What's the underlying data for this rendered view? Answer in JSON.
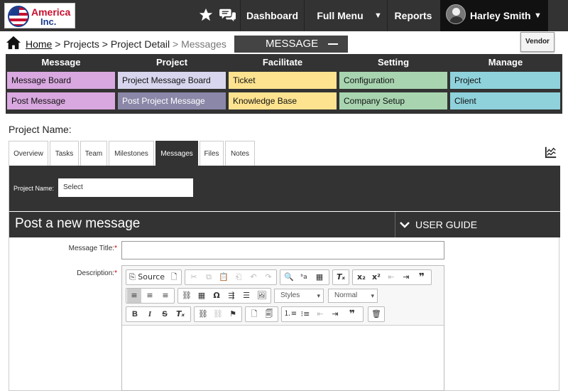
{
  "header": {
    "logo_line1": "America",
    "logo_line2": "Inc.",
    "nav": {
      "dashboard": "Dashboard",
      "full_menu": "Full Menu",
      "reports": "Reports"
    },
    "user_name": "Harley Smith",
    "icons": [
      "star-icon",
      "chat-icon",
      "caret-down-icon",
      "avatar"
    ]
  },
  "breadcrumb": {
    "home": "Home",
    "sep": ">",
    "projects": "Projects",
    "project_detail": "Project Detail",
    "current": "Messages"
  },
  "section_tab": "MESSAGE",
  "vendor_button": "Vendor",
  "menu": {
    "columns": [
      {
        "heading": "Message",
        "items": [
          "Message Board",
          "Post Message"
        ],
        "colors": [
          "#d9a8e0",
          "#d9a8e0"
        ]
      },
      {
        "heading": "Project",
        "items": [
          "Project Message Board",
          "Post Project Message"
        ],
        "colors": [
          "#d8d6ee",
          "#8a87a8"
        ]
      },
      {
        "heading": "Facilitate",
        "items": [
          "Ticket",
          "Knowledge Base"
        ],
        "colors": [
          "#fde38f",
          "#fde38f"
        ]
      },
      {
        "heading": "Setting",
        "items": [
          "Configuration",
          "Company Setup"
        ],
        "colors": [
          "#a8d5b0",
          "#a8d5b0"
        ]
      },
      {
        "heading": "Manage",
        "items": [
          "Project",
          "Client"
        ],
        "colors": [
          "#8fd2dc",
          "#8fd2dc"
        ]
      }
    ]
  },
  "project_name_label": "Project Name:",
  "tabs": [
    {
      "label": "Overview",
      "active": false
    },
    {
      "label": "Tasks",
      "active": false
    },
    {
      "label": "Team",
      "active": false
    },
    {
      "label": "Milestones",
      "active": false
    },
    {
      "label": "Messages",
      "active": true
    },
    {
      "label": "Files",
      "active": false
    },
    {
      "label": "Notes",
      "active": false
    }
  ],
  "filter": {
    "label": "Project Name:",
    "select_value": "Select"
  },
  "post": {
    "title": "Post a new message",
    "user_guide": "USER GUIDE"
  },
  "form": {
    "message_title_label": "Message Title:",
    "description_label": "Description:",
    "required_mark": "*",
    "message_title_value": ""
  },
  "editor": {
    "source_label": "Source",
    "styles_label": "Styles",
    "format_label": "Normal"
  }
}
